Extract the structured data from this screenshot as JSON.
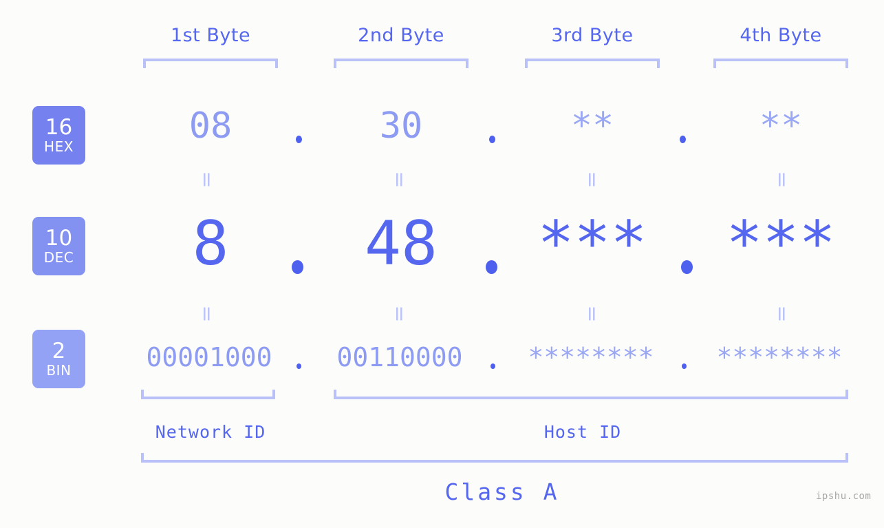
{
  "background_color": "#fcfdfa",
  "accent_color": "#5566ef",
  "accent_light_color": "#8d9bf2",
  "bracket_color": "#b9c1f8",
  "columns": [
    {
      "header": "1st Byte",
      "hex": "08",
      "dec": "8",
      "bin": "00001000"
    },
    {
      "header": "2nd Byte",
      "hex": "30",
      "dec": "48",
      "bin": "00110000"
    },
    {
      "header": "3rd Byte",
      "hex": "**",
      "dec": "***",
      "bin": "********"
    },
    {
      "header": "4th Byte",
      "hex": "**",
      "dec": "***",
      "bin": "********"
    }
  ],
  "rows": [
    {
      "base": "16",
      "name": "HEX",
      "color": "#7481ef"
    },
    {
      "base": "10",
      "name": "DEC",
      "color": "#8391f1"
    },
    {
      "base": "2",
      "name": "BIN",
      "color": "#93a2f4"
    }
  ],
  "separators": {
    "hex": ".",
    "dec": ".",
    "bin": "."
  },
  "equals_marker": "=",
  "sections": {
    "network_id": "Network ID",
    "host_id": "Host ID",
    "class": "Class A"
  },
  "watermark": "ipshu.com"
}
